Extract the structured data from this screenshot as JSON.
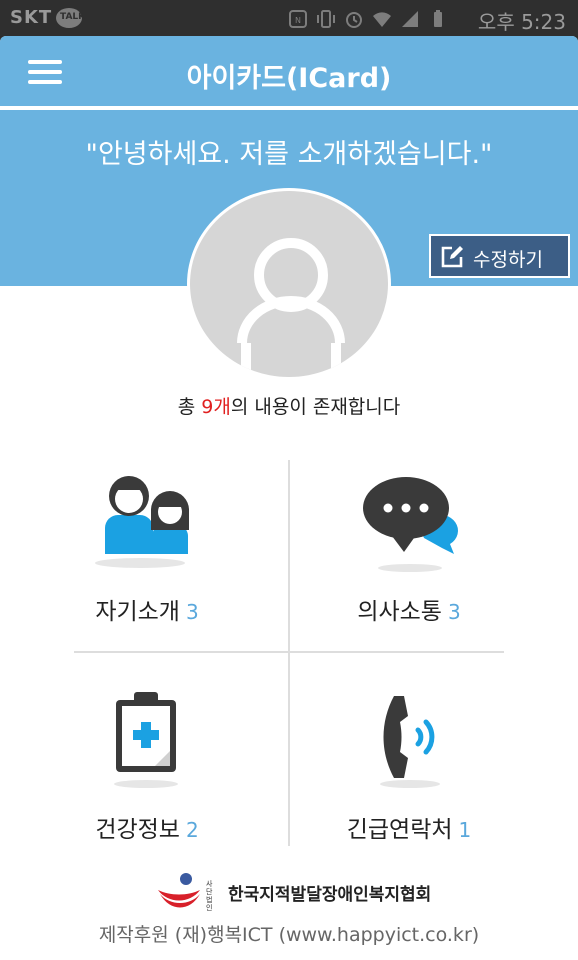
{
  "status_bar": {
    "carrier": "SKT",
    "talk_badge": "TALK",
    "time": "오후 5:23"
  },
  "app_bar": {
    "title": "아이카드(ICard)"
  },
  "hero": {
    "greeting": "\"안녕하세요. 저를 소개하겠습니다.\"",
    "edit_label": "수정하기"
  },
  "summary": {
    "prefix": "총 ",
    "count": "9개",
    "suffix": "의 내용이 존재합니다"
  },
  "categories": [
    {
      "label": "자기소개",
      "count": "3",
      "icon": "people-icon"
    },
    {
      "label": "의사소통",
      "count": "3",
      "icon": "chat-bubble-icon"
    },
    {
      "label": "건강정보",
      "count": "2",
      "icon": "clipboard-medical-icon"
    },
    {
      "label": "긴급연락처",
      "count": "1",
      "icon": "phone-icon"
    }
  ],
  "footer": {
    "org_prefix": "사단\n법인",
    "org_name": "한국지적발달장애인복지협회",
    "credit": "제작후원 (재)행복ICT (www.happyict.co.kr)"
  },
  "colors": {
    "primary": "#6ab3e0",
    "edit_button": "#3c5e86",
    "count_highlight": "#e02020",
    "category_count": "#5aa8dc",
    "icon_dark": "#3a3a3a",
    "icon_blue": "#1ba1e2"
  }
}
